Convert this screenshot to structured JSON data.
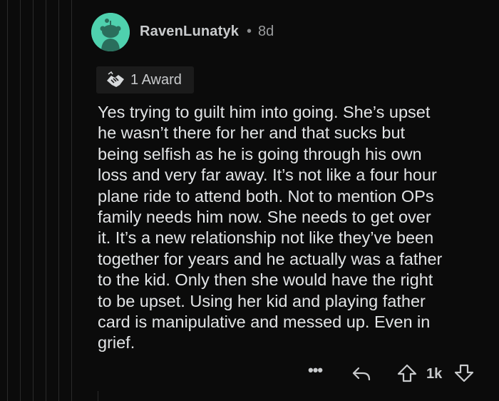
{
  "comment": {
    "author": "RavenLunatyk",
    "separator": "•",
    "age": "8d",
    "award_label": "1 Award",
    "body": "Yes trying to guilt him into going.  She’s upset\nhe wasn’t there for her and that sucks but\nbeing selfish as he is going through his own\nloss and very far away. It’s not like a four hour\nplane ride to attend both. Not to mention OPs\nfamily needs him now. She needs to get over\nit. It’s a new relationship not like they’ve been\ntogether for years and he actually was a father\nto the kid. Only then she would have the right\nto be upset.  Using her kid and playing father\ncard is manipulative and messed up. Even in\ngrief."
  },
  "actions": {
    "more_label": "•••",
    "score": "1k"
  },
  "icons": {
    "avatar": "reddit-snoo-avatar",
    "award": "handshake-award-icon",
    "reply": "reply-arrow-icon",
    "upvote": "upvote-arrow-icon",
    "downvote": "downvote-arrow-icon"
  },
  "colors": {
    "background": "#0b0b0b",
    "avatar_bg": "#4fd1ae",
    "text": "#e2e4e6",
    "meta": "#9a9c9e"
  }
}
